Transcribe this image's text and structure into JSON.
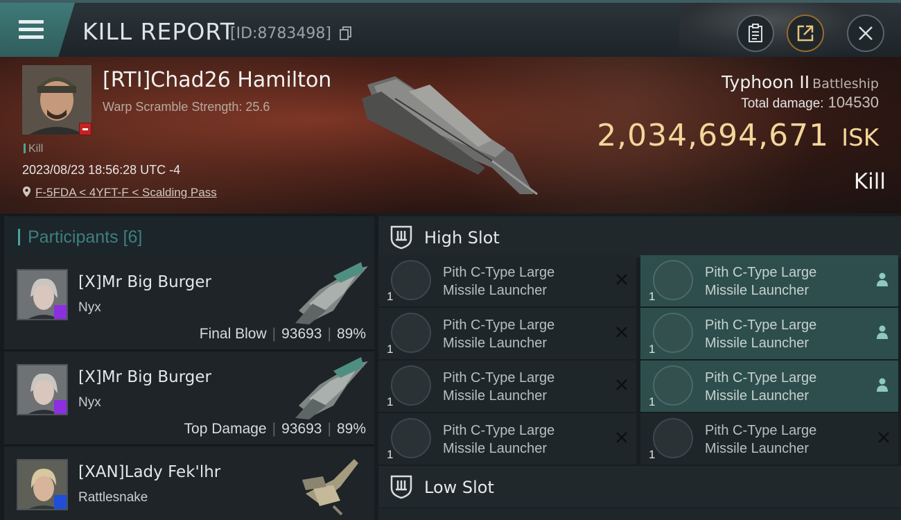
{
  "header": {
    "title": "KILL REPORT",
    "report_id": "[ID:8783498]",
    "buttons": [
      "clipboard",
      "share",
      "close"
    ]
  },
  "victim": {
    "name": "[RTI]Chad26 Hamilton",
    "scramble": "Warp Scramble Strength: 25.6",
    "tag": "Kill",
    "datetime": "2023/08/23 18:56:28 UTC -4",
    "location": "F-5FDA < 4YFT-F < Scalding Pass",
    "ship_name": "Typhoon II",
    "ship_class": "Battleship",
    "damage_label": "Total damage:",
    "damage_value": "104530",
    "isk_value": "2,034,694,671",
    "isk_unit": "ISK",
    "result": "Kill"
  },
  "participants": {
    "title": "Participants [6]",
    "rows": [
      {
        "name": "[X]Mr Big Burger",
        "ship": "Nyx",
        "role": "Final Blow",
        "damage": "93693",
        "percent": "89%",
        "badge": "purple"
      },
      {
        "name": "[X]Mr Big Burger",
        "ship": "Nyx",
        "role": "Top Damage",
        "damage": "93693",
        "percent": "89%",
        "badge": "purple"
      },
      {
        "name": "[XAN]Lady Fek'lhr",
        "ship": "Rattlesnake",
        "role": "",
        "damage": "",
        "percent": "",
        "badge": "blue"
      }
    ]
  },
  "slots": {
    "high_title": "High Slot",
    "low_title": "Low Slot",
    "high_modules": [
      {
        "line1": "Pith C-Type Large",
        "line2": "Missile Launcher",
        "qty": "1",
        "state": "destroyed"
      },
      {
        "line1": "Pith C-Type Large",
        "line2": "Missile Launcher",
        "qty": "1",
        "state": "dropped"
      },
      {
        "line1": "Pith C-Type Large",
        "line2": "Missile Launcher",
        "qty": "1",
        "state": "destroyed"
      },
      {
        "line1": "Pith C-Type Large",
        "line2": "Missile Launcher",
        "qty": "1",
        "state": "dropped"
      },
      {
        "line1": "Pith C-Type Large",
        "line2": "Missile Launcher",
        "qty": "1",
        "state": "destroyed"
      },
      {
        "line1": "Pith C-Type Large",
        "line2": "Missile Launcher",
        "qty": "1",
        "state": "dropped"
      },
      {
        "line1": "Pith C-Type Large",
        "line2": "Missile Launcher",
        "qty": "1",
        "state": "destroyed"
      },
      {
        "line1": "Pith C-Type Large",
        "line2": "Missile Launcher",
        "qty": "1",
        "state": "destroyed"
      }
    ]
  },
  "colors": {
    "accent_teal": "#47a7a2",
    "isk_gold": "#f3d69a",
    "dropped_bg": "#2d4e4d"
  }
}
